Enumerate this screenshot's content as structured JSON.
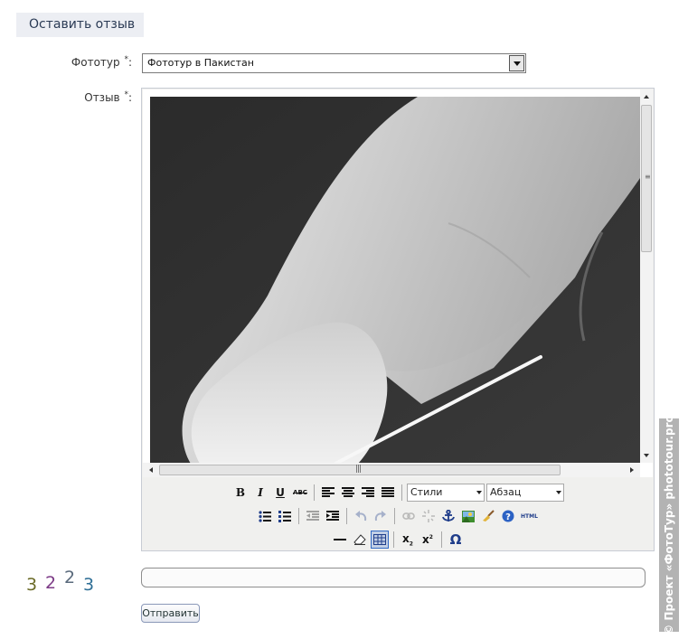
{
  "form": {
    "title": "Оставить отзыв",
    "tour_label": "Фототур",
    "tour_required": "*",
    "tour_value": "Фототур в Пакистан",
    "review_label": "Отзыв",
    "review_required": "*",
    "captcha_digits": [
      "3",
      "2",
      "2",
      "3"
    ],
    "captcha_input_value": "",
    "submit_label": "Отправить"
  },
  "editor": {
    "image": "x-ray-finger-photo",
    "toolbar1": {
      "bold": "B",
      "italic": "I",
      "underline": "U",
      "strike": "ABC",
      "styles_value": "Стили",
      "format_value": "Абзац"
    },
    "toolbar2": {
      "html": "HTML"
    },
    "toolbar3": {
      "subscript": "x",
      "superscript": "x",
      "charmap": "Ω"
    }
  },
  "watermark": {
    "text": "© Проект «ФотоТур» phototour.pro"
  },
  "colors": {
    "header_bg": "#eceef3",
    "editor_bg": "#f0f0ee",
    "active_button": "#316ac5"
  }
}
